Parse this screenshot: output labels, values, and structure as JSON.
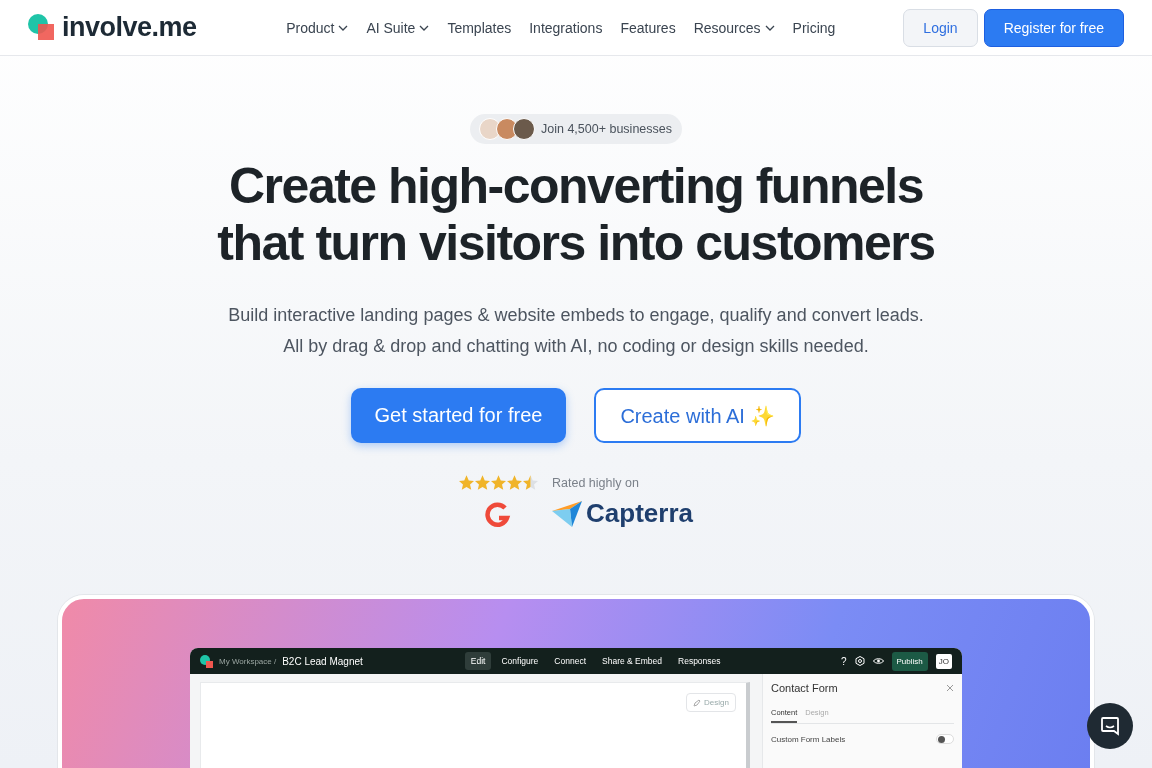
{
  "nav": {
    "logo": "involve.me",
    "links": [
      {
        "label": "Product",
        "dropdown": true
      },
      {
        "label": "AI Suite",
        "dropdown": true
      },
      {
        "label": "Templates",
        "dropdown": false
      },
      {
        "label": "Integrations",
        "dropdown": false
      },
      {
        "label": "Features",
        "dropdown": false
      },
      {
        "label": "Resources",
        "dropdown": true
      },
      {
        "label": "Pricing",
        "dropdown": false
      }
    ],
    "login": "Login",
    "register": "Register for free"
  },
  "hero": {
    "badge": "Join 4,500+ businesses",
    "title_lines": [
      "Create high-converting funnels",
      "that turn visitors into customers"
    ],
    "subtitle_lines": [
      "Build interactive landing pages & website embeds to engage, qualify and convert leads.",
      "All by drag & drop and chatting with AI, no coding or design skills needed."
    ],
    "primary_button": "Get started for free",
    "secondary_button": "Create with AI ✨",
    "rating": {
      "stars": 4.5,
      "label": "Rated highly on",
      "brands": [
        "Capterra"
      ]
    }
  },
  "editor": {
    "breadcrumb": "My Workspace /",
    "project": "B2C Lead Magnet",
    "tabs": [
      {
        "label": "Edit",
        "selected": true
      },
      {
        "label": "Configure",
        "selected": false
      },
      {
        "label": "Connect",
        "selected": false
      },
      {
        "label": "Share & Embed",
        "selected": false
      },
      {
        "label": "Responses",
        "selected": false
      }
    ],
    "help": "?",
    "publish": "Publish",
    "avatar": "JO",
    "design_button": "Design",
    "panel": {
      "title": "Contact Form",
      "tabs": [
        {
          "label": "Content",
          "selected": true
        },
        {
          "label": "Design",
          "selected": false
        }
      ],
      "settings": [
        {
          "label": "Custom Form Labels",
          "on": false
        }
      ]
    }
  }
}
